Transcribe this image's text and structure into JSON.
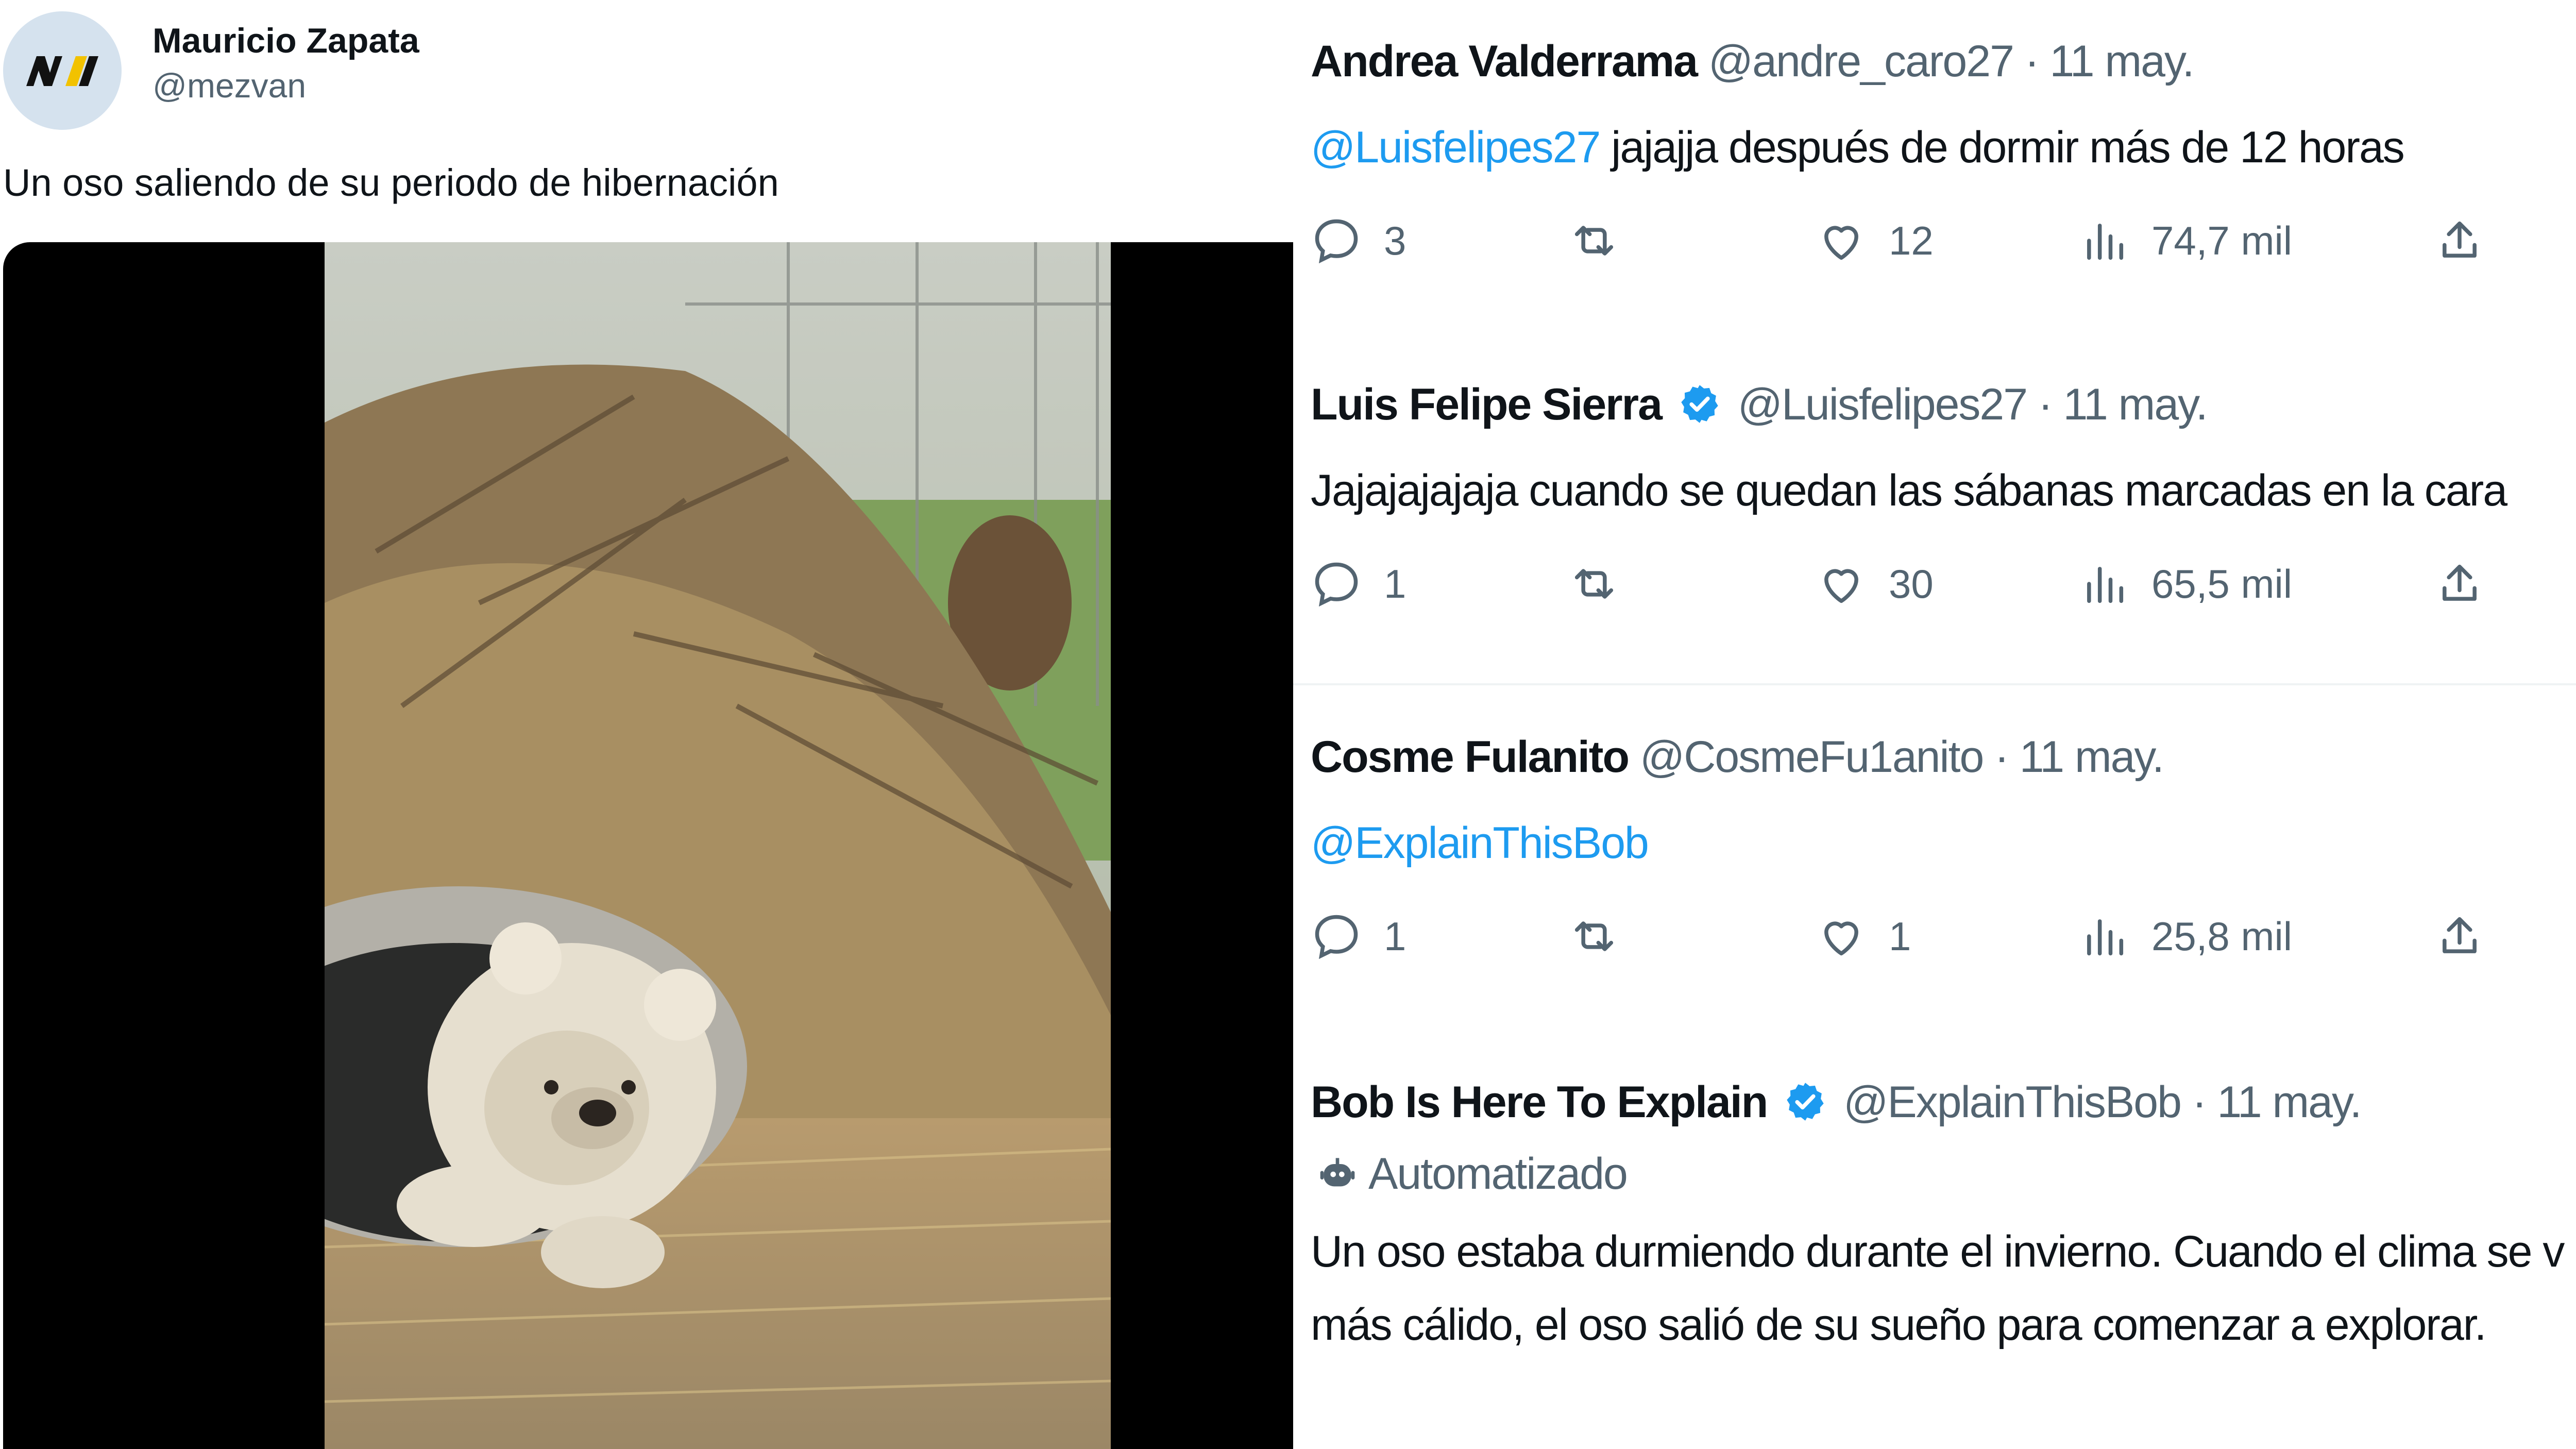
{
  "original_post": {
    "author_name": "Mauricio Zapata",
    "author_handle": "@mezvan",
    "text": "Un oso saliendo de su periodo de hibernación"
  },
  "replies": [
    {
      "name": "Andrea Valderrama",
      "handle": "@andre_caro27",
      "date": "· 11 may.",
      "verified": false,
      "mention": "@Luisfelipes27",
      "text": " jajajja después de dormir más de 12 horas",
      "replies": "3",
      "retweets": "",
      "likes": "12",
      "views": "74,7 mil"
    },
    {
      "name": "Luis Felipe Sierra",
      "handle": "@Luisfelipes27",
      "date": "· 11 may.",
      "verified": true,
      "mention": "",
      "text": "Jajajajajaja cuando se quedan las sábanas marcadas en la cara",
      "replies": "1",
      "retweets": "",
      "likes": "30",
      "views": "65,5 mil"
    },
    {
      "name": "Cosme Fulanito",
      "handle": "@CosmeFu1anito",
      "date": "· 11 may.",
      "verified": false,
      "mention": "@ExplainThisBob",
      "text": "",
      "replies": "1",
      "retweets": "",
      "likes": "1",
      "views": "25,8 mil"
    },
    {
      "name": "Bob Is Here To Explain",
      "handle": "@ExplainThisBob",
      "date": "· 11 may.",
      "verified": true,
      "automated_label": "Automatizado",
      "text_line1": "Un oso estaba durmiendo durante el invierno. Cuando el clima se v",
      "text_line2": "más cálido, el oso salió de su sueño para comenzar a explorar."
    }
  ],
  "colors": {
    "link": "#1d9bf0",
    "secondary": "#536471",
    "verified": "#1d9bf0"
  }
}
